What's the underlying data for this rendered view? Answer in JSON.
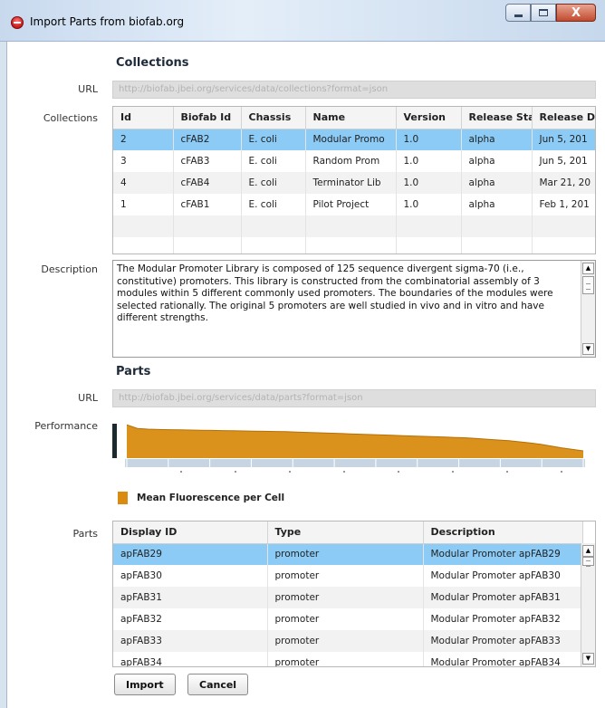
{
  "window": {
    "title": "Import Parts from biofab.org",
    "close_glyph": "X"
  },
  "collections": {
    "heading": "Collections",
    "url_label": "URL",
    "url_value": "http://biofab.jbei.org/services/data/collections?format=json",
    "table_label": "Collections",
    "columns": [
      "Id",
      "Biofab Id",
      "Chassis",
      "Name",
      "Version",
      "Release Sta",
      "Release D"
    ],
    "rows": [
      [
        "2",
        "cFAB2",
        "E. coli",
        "Modular Promo",
        "1.0",
        "alpha",
        "Jun 5, 201"
      ],
      [
        "3",
        "cFAB3",
        "E. coli",
        "Random Prom",
        "1.0",
        "alpha",
        "Jun 5, 201"
      ],
      [
        "4",
        "cFAB4",
        "E. coli",
        "Terminator Lib",
        "1.0",
        "alpha",
        "Mar 21, 20"
      ],
      [
        "1",
        "cFAB1",
        "E. coli",
        "Pilot Project",
        "1.0",
        "alpha",
        "Feb 1, 201"
      ]
    ],
    "selected_row": 0,
    "description_label": "Description",
    "description": "The Modular Promoter Library is composed of 125 sequence divergent sigma-70 (i.e., constitutive) promoters. This library is constructed from the combinatorial assembly of 3 modules within 5 different commonly used promoters.  The boundaries of the modules were selected rationally.  The original 5 promoters are well studied in vivo and in vitro and have different strengths."
  },
  "parts": {
    "heading": "Parts",
    "url_label": "URL",
    "url_value": "http://biofab.jbei.org/services/data/parts?format=json",
    "performance_label": "Performance",
    "table_label": "Parts",
    "columns": [
      "Display ID",
      "Type",
      "Description"
    ],
    "rows": [
      [
        "apFAB29",
        "promoter",
        "Modular Promoter apFAB29"
      ],
      [
        "apFAB30",
        "promoter",
        "Modular Promoter apFAB30"
      ],
      [
        "apFAB31",
        "promoter",
        "Modular Promoter apFAB31"
      ],
      [
        "apFAB32",
        "promoter",
        "Modular Promoter apFAB32"
      ],
      [
        "apFAB33",
        "promoter",
        "Modular Promoter apFAB33"
      ],
      [
        "apFAB34",
        "promoter",
        "Modular Promoter apFAB34"
      ]
    ],
    "selected_row": 0
  },
  "chart_data": {
    "type": "area",
    "series": [
      {
        "name": "Mean Fluorescence per Cell",
        "color": "#d98c10",
        "values": [
          0.92,
          0.82,
          0.8,
          0.79,
          0.785,
          0.78,
          0.775,
          0.77,
          0.765,
          0.76,
          0.755,
          0.75,
          0.745,
          0.74,
          0.735,
          0.73,
          0.72,
          0.71,
          0.7,
          0.69,
          0.68,
          0.67,
          0.66,
          0.65,
          0.64,
          0.63,
          0.62,
          0.61,
          0.6,
          0.59,
          0.58,
          0.57,
          0.56,
          0.54,
          0.52,
          0.5,
          0.48,
          0.45,
          0.42,
          0.38,
          0.33,
          0.28,
          0.24,
          0.2
        ]
      }
    ],
    "ylim": [
      0,
      1
    ],
    "grid": false,
    "legend": "bottom"
  },
  "actions": {
    "import_label": "Import",
    "cancel_label": "Cancel"
  }
}
